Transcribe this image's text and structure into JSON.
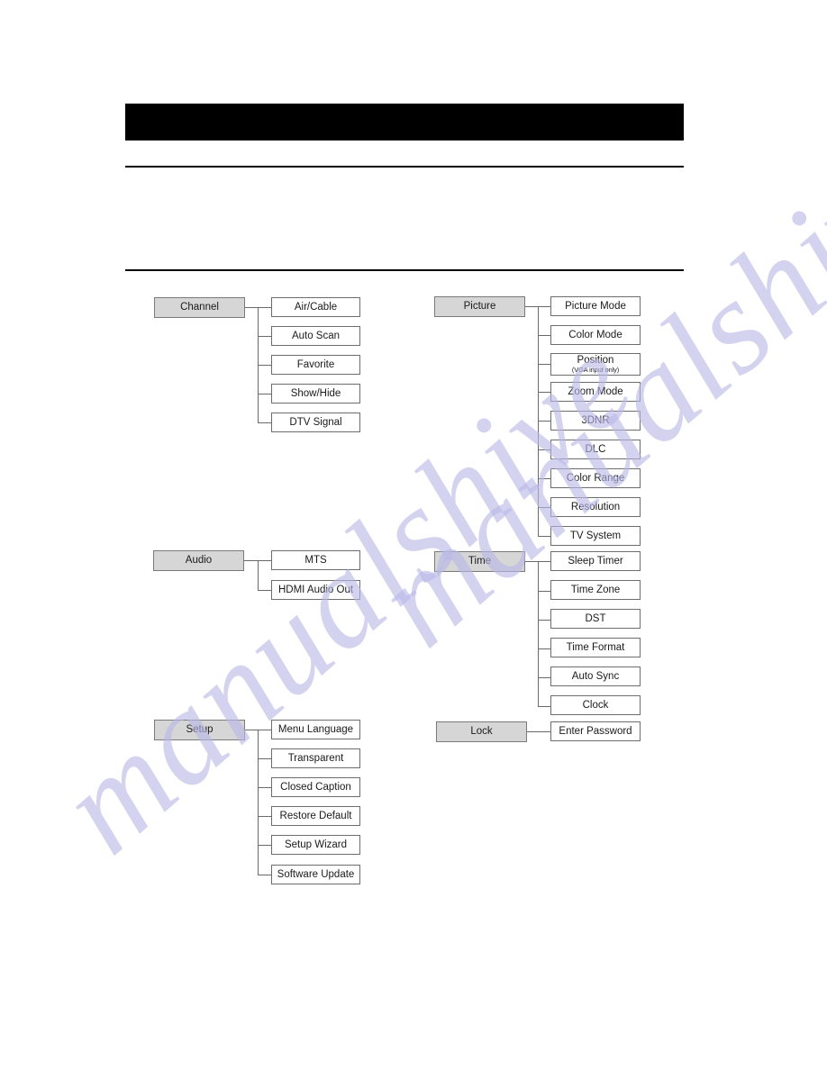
{
  "document": {
    "header_bar": {
      "visible": true,
      "color": "#000000",
      "text": ""
    },
    "rules": 2
  },
  "watermark": {
    "text": "manualshive",
    "color": "#b9b9e8"
  },
  "menu_tree": {
    "left_column": [
      {
        "parent": "Channel",
        "children": [
          {
            "label": "Air/Cable"
          },
          {
            "label": "Auto Scan"
          },
          {
            "label": "Favorite"
          },
          {
            "label": "Show/Hide"
          },
          {
            "label": "DTV Signal"
          }
        ]
      },
      {
        "parent": "Audio",
        "children": [
          {
            "label": "MTS"
          },
          {
            "label": "HDMI Audio Out"
          }
        ]
      },
      {
        "parent": "Setup",
        "children": [
          {
            "label": "Menu Language"
          },
          {
            "label": "Transparent"
          },
          {
            "label": "Closed Caption"
          },
          {
            "label": "Restore Default"
          },
          {
            "label": "Setup Wizard"
          },
          {
            "label": "Software Update"
          }
        ]
      }
    ],
    "right_column": [
      {
        "parent": "Picture",
        "children": [
          {
            "label": "Picture Mode"
          },
          {
            "label": "Color Mode"
          },
          {
            "label": "Position",
            "sublabel": "(VGA input only)"
          },
          {
            "label": "Zoom Mode"
          },
          {
            "label": "3DNR"
          },
          {
            "label": "DLC"
          },
          {
            "label": "Color Range"
          },
          {
            "label": "Resolution"
          },
          {
            "label": "TV System"
          }
        ]
      },
      {
        "parent": "Time",
        "children": [
          {
            "label": "Sleep Timer"
          },
          {
            "label": "Time Zone"
          },
          {
            "label": "DST"
          },
          {
            "label": "Time Format"
          },
          {
            "label": "Auto Sync"
          },
          {
            "label": "Clock"
          }
        ]
      },
      {
        "parent": "Lock",
        "children": [
          {
            "label": "Enter Password"
          }
        ]
      }
    ]
  }
}
